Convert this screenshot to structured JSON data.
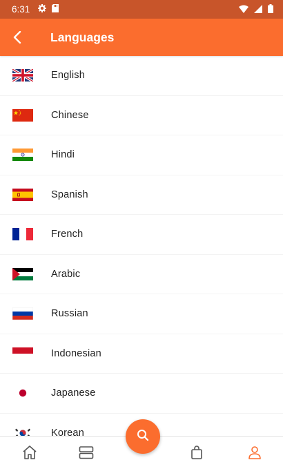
{
  "status": {
    "time": "6:31"
  },
  "header": {
    "title": "Languages"
  },
  "languages": [
    {
      "label": "English",
      "flag": "uk-flag-icon"
    },
    {
      "label": "Chinese",
      "flag": "china-flag-icon"
    },
    {
      "label": "Hindi",
      "flag": "india-flag-icon"
    },
    {
      "label": "Spanish",
      "flag": "spain-flag-icon"
    },
    {
      "label": "French",
      "flag": "france-flag-icon"
    },
    {
      "label": "Arabic",
      "flag": "palestine-flag-icon"
    },
    {
      "label": "Russian",
      "flag": "russia-flag-icon"
    },
    {
      "label": "Indonesian",
      "flag": "indonesia-flag-icon"
    },
    {
      "label": "Japanese",
      "flag": "japan-flag-icon"
    },
    {
      "label": "Korean",
      "flag": "korea-flag-icon"
    }
  ],
  "colors": {
    "accent": "#fb6d2e",
    "statusbar": "#c8552a",
    "active_nav": "#fb6d2e",
    "inactive_nav": "#555555"
  },
  "bottom_nav": [
    {
      "icon": "home-icon",
      "active": false
    },
    {
      "icon": "layers-icon",
      "active": false
    },
    {
      "icon": "search-icon",
      "active": false
    },
    {
      "icon": "shopping-bag-icon",
      "active": false
    },
    {
      "icon": "person-icon",
      "active": true
    }
  ]
}
